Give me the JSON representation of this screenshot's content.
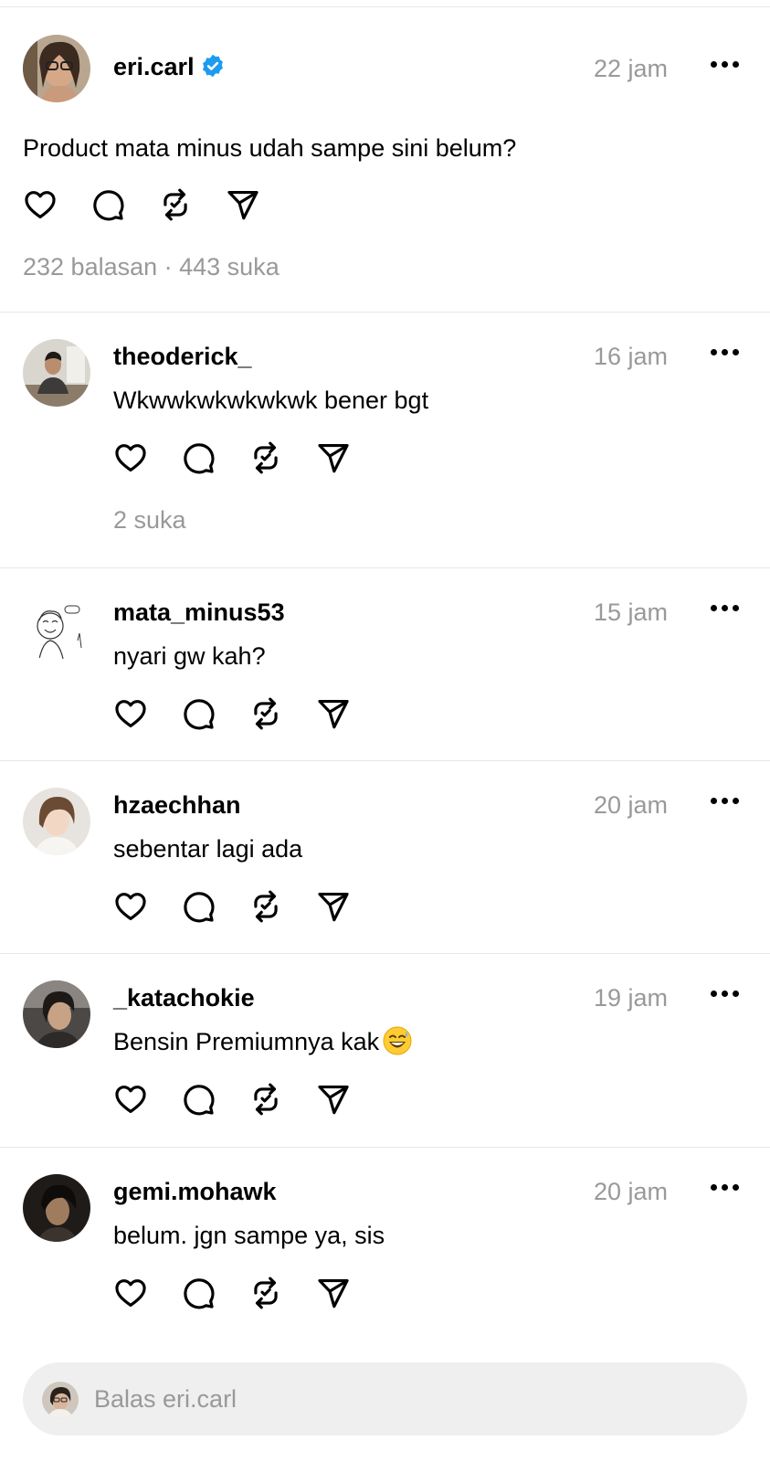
{
  "post": {
    "username": "eri.carl",
    "verified": true,
    "time": "22 jam",
    "text": "Product mata minus udah sampe sini belum?",
    "stats": "232 balasan · 443 suka"
  },
  "replies": [
    {
      "username": "theoderick_",
      "time": "16 jam",
      "text": "Wkwwkwkwkwkwk bener bgt",
      "stats": "2 suka"
    },
    {
      "username": "mata_minus53",
      "time": "15 jam",
      "text": "nyari gw kah?"
    },
    {
      "username": "hzaechhan",
      "time": "20 jam",
      "text": "sebentar lagi ada"
    },
    {
      "username": "_katachokie",
      "time": "19 jam",
      "text": "Bensin Premiumnya kak",
      "emoji": "grinning-sweat-emoji"
    },
    {
      "username": "gemi.mohawk",
      "time": "20 jam",
      "text": "belum. jgn sampe ya, sis"
    }
  ],
  "composer": {
    "placeholder": "Balas eri.carl"
  },
  "icons": [
    "heart-icon",
    "comment-icon",
    "repost-icon",
    "share-icon",
    "more-icon",
    "verified-icon"
  ],
  "colors": {
    "verified": "#1d9bf0",
    "muted_text": "#999999",
    "divider": "#e6e6e6",
    "composer_bg": "#efefef"
  }
}
